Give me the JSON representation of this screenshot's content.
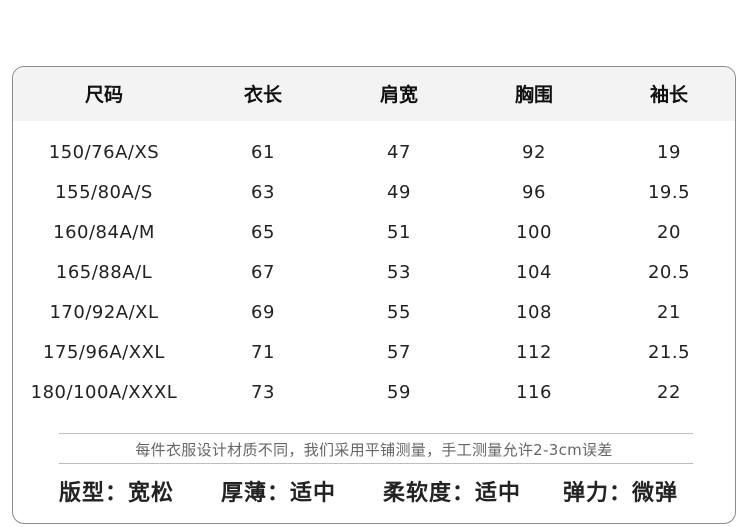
{
  "table": {
    "headers": [
      "尺码",
      "衣长",
      "肩宽",
      "胸围",
      "袖长"
    ],
    "rows": [
      [
        "150/76A/XS",
        "61",
        "47",
        "92",
        "19"
      ],
      [
        "155/80A/S",
        "63",
        "49",
        "96",
        "19.5"
      ],
      [
        "160/84A/M",
        "65",
        "51",
        "100",
        "20"
      ],
      [
        "165/88A/L",
        "67",
        "53",
        "104",
        "20.5"
      ],
      [
        "170/92A/XL",
        "69",
        "55",
        "108",
        "21"
      ],
      [
        "175/96A/XXL",
        "71",
        "57",
        "112",
        "21.5"
      ],
      [
        "180/100A/XXXL",
        "73",
        "59",
        "116",
        "22"
      ]
    ]
  },
  "note": "每件衣服设计材质不同，我们采用平铺测量，手工测量允许2-3cm误差",
  "attributes": [
    "版型：宽松",
    "厚薄：适中",
    "柔软度：适中",
    "弹力：微弹"
  ]
}
